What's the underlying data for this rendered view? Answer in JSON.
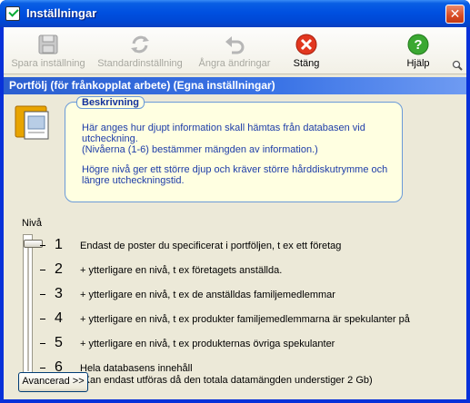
{
  "window": {
    "title": "Inställningar",
    "close_glyph": "✕"
  },
  "toolbar": {
    "save_label": "Spara inställning",
    "default_label": "Standardinställning",
    "undo_label": "Ångra ändringar",
    "close_label": "Stäng",
    "help_label": "Hjälp"
  },
  "section": {
    "title": "Portfölj (för frånkopplat arbete) (Egna inställningar)"
  },
  "description": {
    "legend": "Beskrivning",
    "para1_line1": "Här anges hur djupt information skall hämtas från databasen vid",
    "para1_line2": "utcheckning.",
    "para2": "(Nivåerna (1-6) bestämmer mängden av information.)",
    "para3_line1": "Högre nivå ger ett större djup och kräver större hårddiskutrymme och",
    "para3_line2": "längre utcheckningstid."
  },
  "level": {
    "label": "Nivå",
    "selected": 1,
    "items": [
      {
        "num": "1",
        "text": "Endast de poster du specificerat i portföljen, t ex ett företag",
        "text2": ""
      },
      {
        "num": "2",
        "text": "+ ytterligare en nivå, t ex företagets anställda.",
        "text2": ""
      },
      {
        "num": "3",
        "text": "+ ytterligare en nivå, t ex de anställdas familjemedlemmar",
        "text2": ""
      },
      {
        "num": "4",
        "text": "+ ytterligare en nivå, t ex produkter familjemedlemmarna är spekulanter på",
        "text2": ""
      },
      {
        "num": "5",
        "text": "+ ytterligare en nivå, t ex produkternas övriga spekulanter",
        "text2": ""
      },
      {
        "num": "6",
        "text": "Hela databasens innehåll",
        "text2": "(Kan endast utföras då den totala datamängden understiger 2 Gb)"
      }
    ]
  },
  "advanced": {
    "label": "Avancerad >>"
  },
  "colors": {
    "title_bar": "#0050e0",
    "section_bar": "#3b74e6",
    "desc_bg": "#ffffe1",
    "desc_text": "#1e3da8"
  },
  "icons": [
    "save-icon",
    "refresh-icon",
    "undo-icon",
    "stop-icon",
    "help-icon",
    "portfolio-icon",
    "magnifier-icon"
  ]
}
